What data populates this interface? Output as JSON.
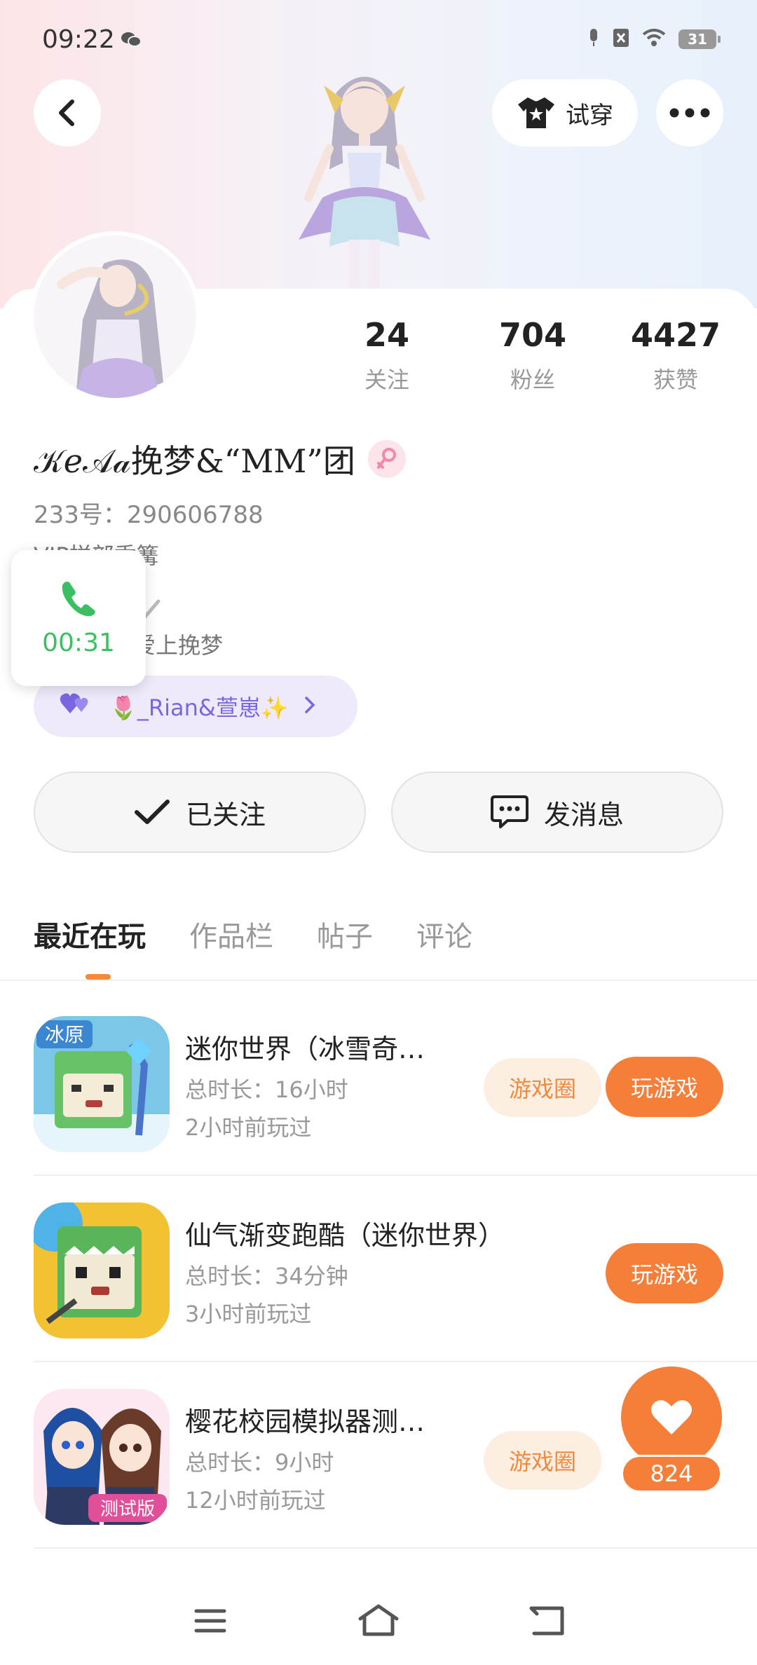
{
  "status_bar": {
    "time": "09:22",
    "battery": "31"
  },
  "header": {
    "try_on_label": "试穿"
  },
  "profile": {
    "stats": [
      {
        "value": "24",
        "label": "关注"
      },
      {
        "value": "704",
        "label": "粉丝"
      },
      {
        "value": "4427",
        "label": "获赞"
      }
    ],
    "name": "𝒦𝑒𝒜𝒶挽梦&“MM”团",
    "uid": "233号：290606788",
    "bio_line1": "VIP样部委篝",
    "bio_line2": "爱上挽梦",
    "cp_text": "🌷_Rian&萱崽✨"
  },
  "call_overlay": {
    "duration": "00:31"
  },
  "actions": {
    "follow_label": "已关注",
    "message_label": "发消息"
  },
  "tabs": [
    "最近在玩",
    "作品栏",
    "帖子",
    "评论"
  ],
  "games": [
    {
      "title": "迷你世界（冰雪奇…",
      "total": "总时长：16小时",
      "last_played": "2小时前玩过",
      "circle_label": "游戏圈",
      "play_label": "玩游戏",
      "icon_badge": "冰原"
    },
    {
      "title": "仙气渐变跑酷（迷你世界）",
      "total": "总时长：34分钟",
      "last_played": "3小时前玩过",
      "play_label": "玩游戏"
    },
    {
      "title": "樱花校园模拟器测…",
      "total": "总时长：9小时",
      "last_played": "12小时前玩过",
      "circle_label": "游戏圈",
      "icon_badge": "测试版"
    }
  ],
  "like_fab": {
    "count": "824"
  },
  "colors": {
    "accent": "#f57f38",
    "call_green": "#3cbf63",
    "cp_purple": "#7a66e0"
  }
}
